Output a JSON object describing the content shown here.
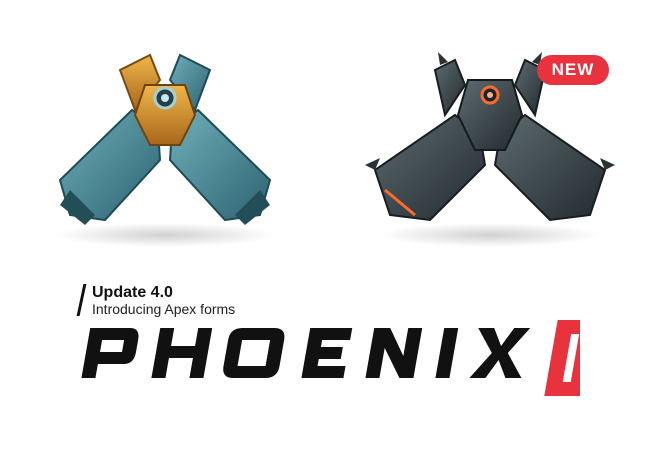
{
  "badge": {
    "label": "NEW"
  },
  "update": {
    "title": "Update 4.0",
    "subtitle": "Introducing Apex forms"
  },
  "logo": {
    "wordmark": "PHOENIX",
    "numeral": "II"
  },
  "colors": {
    "accent": "#e8323d",
    "text": "#111111",
    "ship_teal": "#3e7f8c",
    "ship_gold": "#c98a2a",
    "ship_dark": "#2f3a3f",
    "ship_glow": "#ff6a2a"
  },
  "icons": [
    "ship-classic-icon",
    "ship-apex-icon"
  ]
}
